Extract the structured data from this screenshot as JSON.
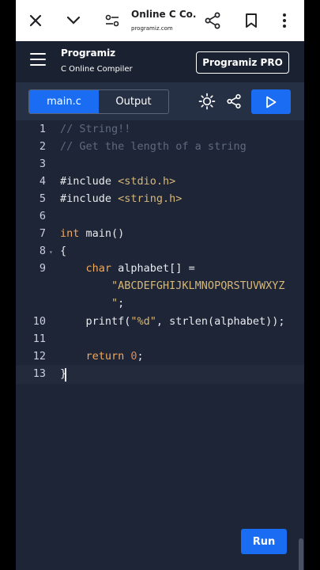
{
  "browser": {
    "tab_title": "Online C Co...",
    "url": "programiz.com"
  },
  "header": {
    "brand": "Programiz",
    "subtitle": "C Online Compiler",
    "pro_button": "Programiz PRO"
  },
  "toolbar": {
    "file_tab": "main.c",
    "output_tab": "Output"
  },
  "editor": {
    "line_numbers": [
      "1",
      "2",
      "3",
      "4",
      "5",
      "6",
      "7",
      "8",
      "9",
      "10",
      "11",
      "12",
      "13"
    ],
    "lines": {
      "l1": "// String!!",
      "l2": "// Get the length of a string",
      "l4_a": "#include ",
      "l4_b": "<stdio.h>",
      "l5_a": "#include ",
      "l5_b": "<string.h>",
      "l7_a": "int",
      "l7_b": " main()",
      "l8": "{",
      "l9_a": "    char",
      "l9_b": " alphabet[] =",
      "l9_c": "        \"ABCDEFGHIJKLMNOPQRSTUVWXYZ",
      "l9_d": "        \"",
      "l9_e": ";",
      "l10_a": "    printf(",
      "l10_b": "\"%d\"",
      "l10_c": ", strlen(alphabet));",
      "l12_a": "    return",
      "l12_b": " 0",
      "l12_c": ";",
      "l13": "}"
    }
  },
  "run_button": "Run"
}
